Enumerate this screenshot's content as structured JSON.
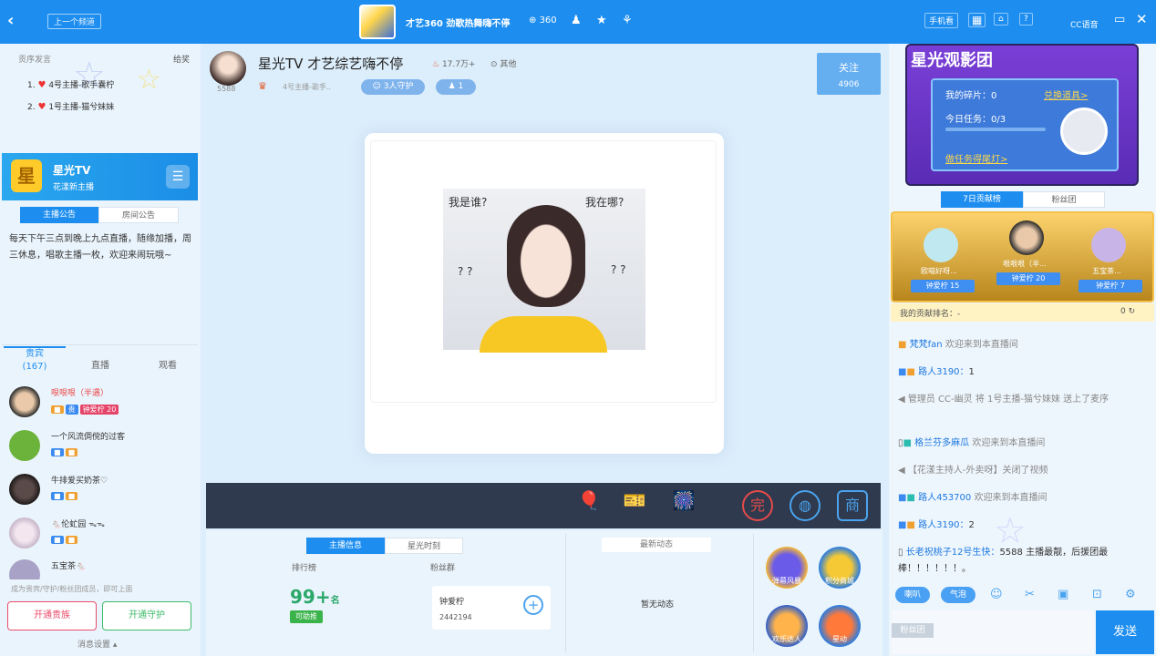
{
  "topbar": {
    "back_icon": "‹",
    "prev_label": "上一个频道",
    "title": "才艺360 劲歌热舞嗨不停",
    "viewers": "360",
    "icons": [
      "user-icon",
      "star-icon",
      "share-icon"
    ],
    "right_buttons": [
      "手机看",
      "窗口",
      "最小化",
      "?"
    ],
    "cc": "CC语音"
  },
  "left": {
    "rank_title": "贡序发言",
    "rank_more": "给奖",
    "rank": [
      {
        "no": "1.",
        "name": "4号主播-歌手囊柠"
      },
      {
        "no": "2.",
        "name": "1号主播-猫兮妹妹"
      }
    ],
    "anchor": {
      "name": "星光TV",
      "sub": "花漾新主播",
      "logo": "星"
    },
    "tabs": [
      "主播公告",
      "房间公告"
    ],
    "notice": "每天下午三点到晚上九点直播，随缘加播，周三休息，唱歌主播一枚，欢迎来闹玩哦~",
    "list_tabs": [
      "贵宾\n(167)",
      "直播",
      "观看"
    ],
    "users": [
      {
        "name": "哏哏哏（半遇）",
        "badge": "钟爱柠 20"
      },
      {
        "name": "一个风流倜傥的过客",
        "badge": ""
      },
      {
        "name": "牛排爱买奶茶♡",
        "badge": ""
      },
      {
        "name": "🐁伦虻园 ᯓᯓ",
        "badge": ""
      },
      {
        "name": "五宝茶🐁",
        "badge": ""
      }
    ],
    "tip": "成为贵宾/守护/粉丝团成员，即可上面",
    "btn_noble": "开通贵族",
    "btn_guard": "开通守护",
    "msgset": "消息设置"
  },
  "stream": {
    "fans": "5588",
    "room_title": "星光TV 才艺综艺嗨不停",
    "hot": "17.7万+",
    "more": "其他",
    "tag": "4号主播-歌手..",
    "guard": "3人守护",
    "viewers": "1",
    "follow_label": "关注",
    "follow_count": "4906",
    "photo_text": [
      "我是谁?",
      "我在哪?",
      "? ?",
      "? ?"
    ]
  },
  "gifts": [
    "balloon",
    "ticket",
    "fireworks"
  ],
  "bottom": {
    "tabs": [
      "主播信息",
      "星光时刻"
    ],
    "rank_label": "排行榜",
    "rank_value": "99+",
    "rank_unit": "名",
    "rank_btn": "可助推",
    "fan_label": "粉丝群",
    "fan_name": "钟爱柠",
    "fan_id": "2442194",
    "latest": "最新动态",
    "nodyn": "暂无动态",
    "acts": [
      "弹幕风暴",
      "积分商城",
      "欢乐达人",
      "星动"
    ]
  },
  "right": {
    "promo_title": "星光观影团",
    "fragments": "我的碎片：0",
    "exchange": "兑换道具>",
    "task": "今日任务：0/3",
    "do_task": "做任务得尾灯>",
    "tabs": [
      "7日贡献榜",
      "粉丝团"
    ],
    "contrib": [
      {
        "name": "欧喵好呀...",
        "val": "钟爱柠 15"
      },
      {
        "name": "哏哏哏（半...",
        "val": "钟爱柠 20"
      },
      {
        "name": "五宝茶...",
        "val": "钟爱柠 7"
      }
    ],
    "myrank": "我的贡献排名：-",
    "myval": "0",
    "chat": [
      {
        "u": "梵梵fan",
        "m": "欢迎来到本直播间"
      },
      {
        "u": "路人3190：",
        "m": "1"
      },
      {
        "u": "管理员 CC-幽灵",
        "m": "将 1号主播-猫兮妹妹 送上了麦序"
      },
      {
        "u": "格兰芬多麻瓜",
        "m": "欢迎来到本直播间"
      },
      {
        "u": "【花漾主持人-外卖呀】",
        "m": "关闭了视频"
      },
      {
        "u": "路人453700",
        "m": "欢迎来到本直播间"
      },
      {
        "u": "路人3190：",
        "m": "2"
      },
      {
        "u": "长老祝桃子12号生快：",
        "m": "5588 主播最靓，后援团最棒！！！！！！。"
      }
    ],
    "chat_btns": [
      "喇叭",
      "气泡"
    ],
    "fangroup": "粉丝团",
    "send": "发送"
  }
}
